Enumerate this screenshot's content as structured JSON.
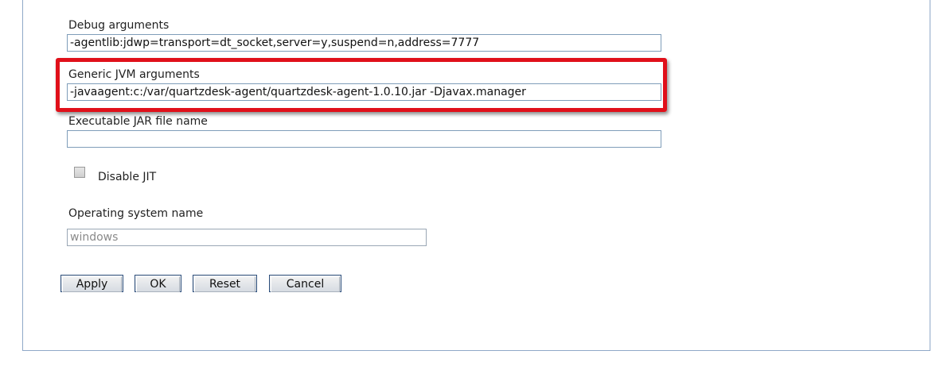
{
  "fields": {
    "debug": {
      "label": "Debug arguments",
      "value": "-agentlib:jdwp=transport=dt_socket,server=y,suspend=n,address=7777"
    },
    "generic_jvm": {
      "label": "Generic JVM arguments",
      "value": "-javaagent:c:/var/quartzdesk-agent/quartzdesk-agent-1.0.10.jar -Djavax.manager"
    },
    "executable_jar": {
      "label": "Executable JAR file name",
      "value": ""
    },
    "disable_jit": {
      "label": "Disable JIT",
      "checked": false
    },
    "os_name": {
      "label": "Operating system name",
      "value": "windows"
    }
  },
  "buttons": {
    "apply": "Apply",
    "ok": "OK",
    "reset": "Reset",
    "cancel": "Cancel"
  },
  "colors": {
    "highlight": "#e0101a",
    "panel_border": "#8fa8c8",
    "input_border": "#7f9db9"
  }
}
